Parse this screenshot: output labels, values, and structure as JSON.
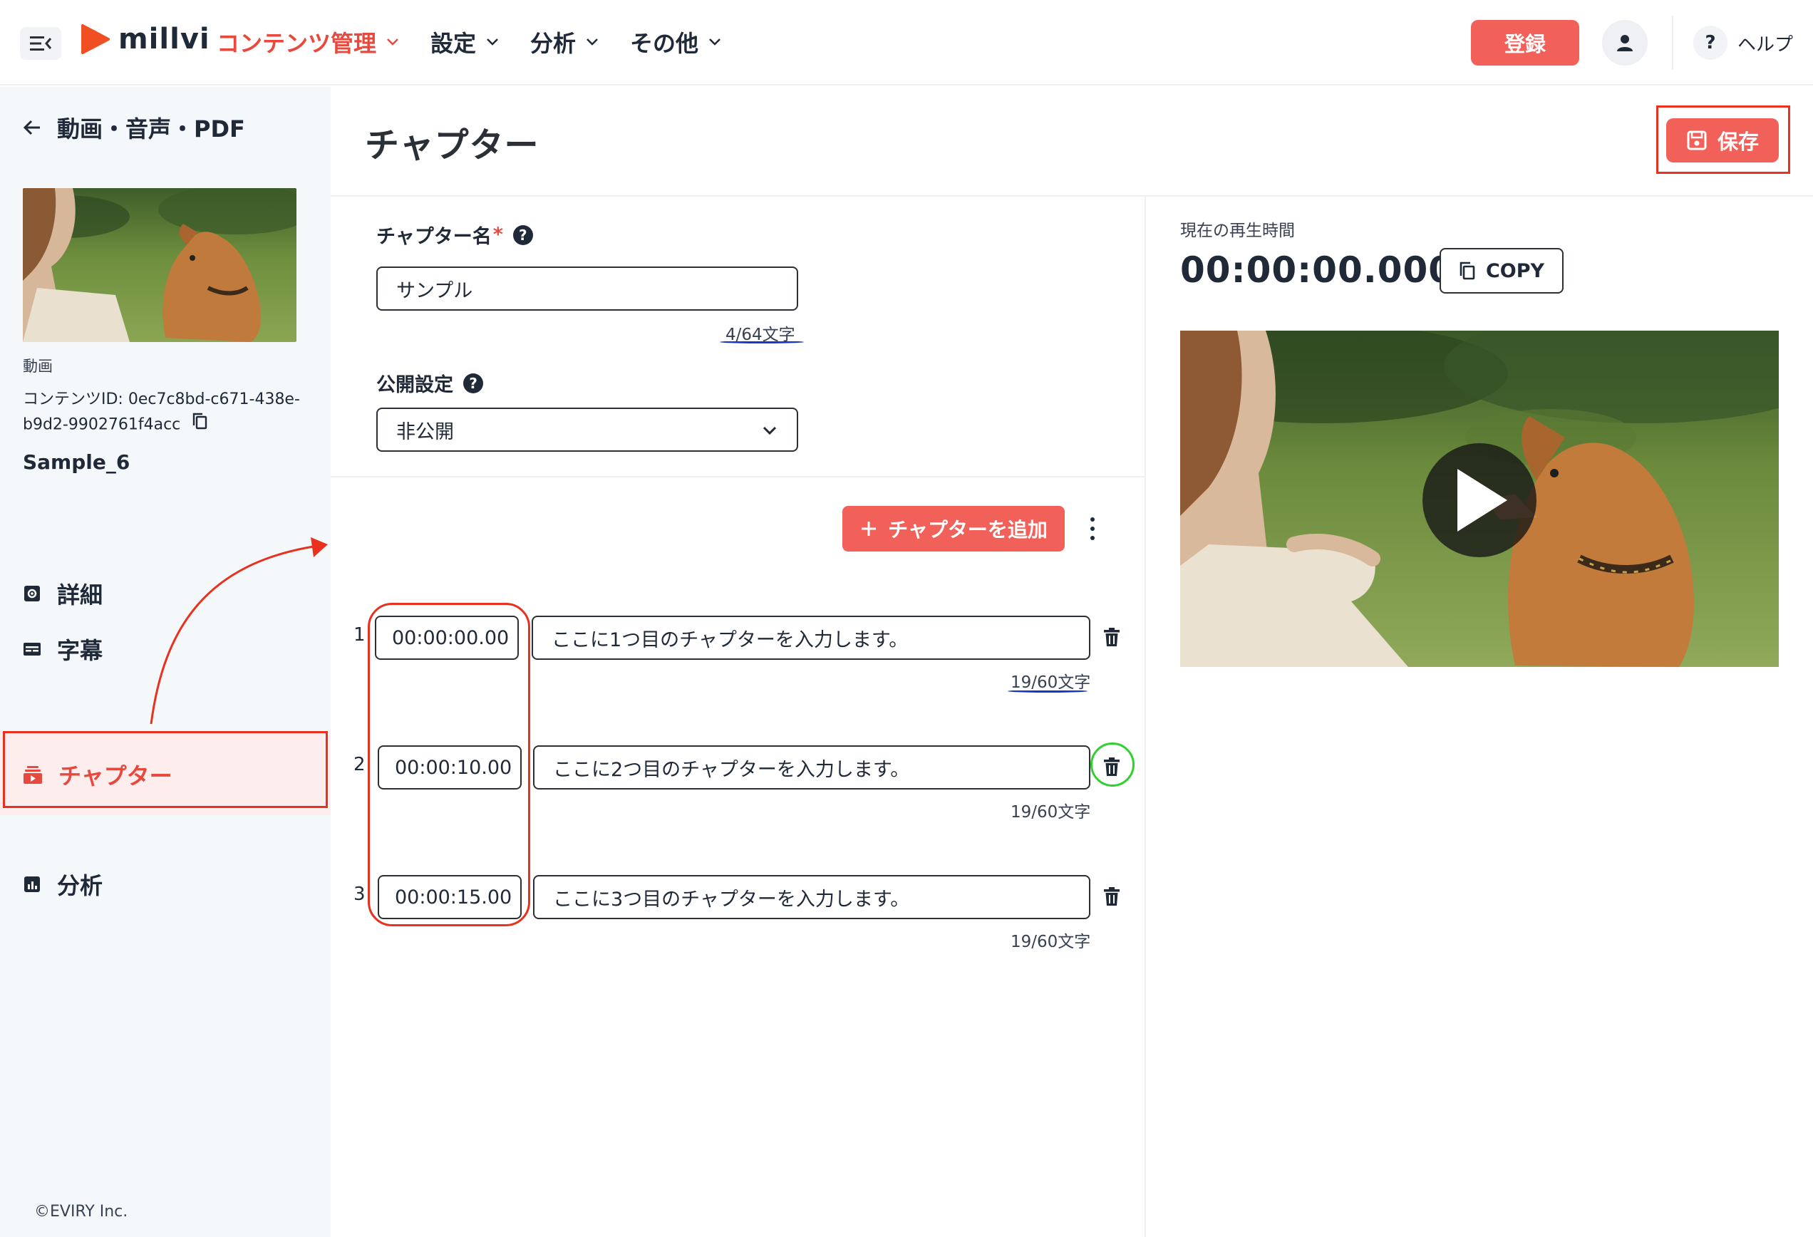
{
  "header": {
    "logo_text": "millvi",
    "nav": [
      {
        "label": "コンテンツ管理",
        "active": true
      },
      {
        "label": "設定",
        "active": false
      },
      {
        "label": "分析",
        "active": false
      },
      {
        "label": "その他",
        "active": false
      }
    ],
    "register_label": "登録",
    "help_label": "ヘルプ",
    "help_glyph": "?"
  },
  "sidebar": {
    "back_label": "動画・音声・PDF",
    "media_type": "動画",
    "content_id_line1": "コンテンツID: 0ec7c8bd-c671-438e-",
    "content_id_line2": "b9d2-9902761f4acc",
    "content_name": "Sample_6",
    "items": [
      {
        "label": "詳細",
        "icon": "settings-icon"
      },
      {
        "label": "字幕",
        "icon": "subtitles-icon"
      },
      {
        "label": "チャプター",
        "icon": "chapter-icon",
        "active": true
      },
      {
        "label": "分析",
        "icon": "analytics-icon"
      }
    ],
    "copyright": "©EVIRY Inc."
  },
  "main": {
    "title": "チャプター",
    "save_label": "保存",
    "chapter_name_label": "チャプター名",
    "required_mark": "*",
    "chapter_name_value": "サンプル",
    "chapter_name_counter": "4/64文字",
    "visibility_label": "公開設定",
    "visibility_value": "非公開",
    "add_chapter_label": "チャプターを追加",
    "chapters": [
      {
        "num": "1",
        "time": "00:00:00.00",
        "text": "ここに1つ目のチャプターを入力します。",
        "counter": "19/60文字"
      },
      {
        "num": "2",
        "time": "00:00:10.00",
        "text": "ここに2つ目のチャプターを入力します。",
        "counter": "19/60文字"
      },
      {
        "num": "3",
        "time": "00:00:15.00",
        "text": "ここに3つ目のチャプターを入力します。",
        "counter": "19/60文字"
      }
    ]
  },
  "player": {
    "current_time_label": "現在の再生時間",
    "current_time": "00:00:00.000",
    "copy_label": "COPY"
  },
  "colors": {
    "accent": "#f2605a",
    "accent_text": "#e8493f",
    "annotation_red": "#e8321f",
    "annotation_green": "#2fd12f",
    "annotation_blue": "#1a36c9"
  }
}
